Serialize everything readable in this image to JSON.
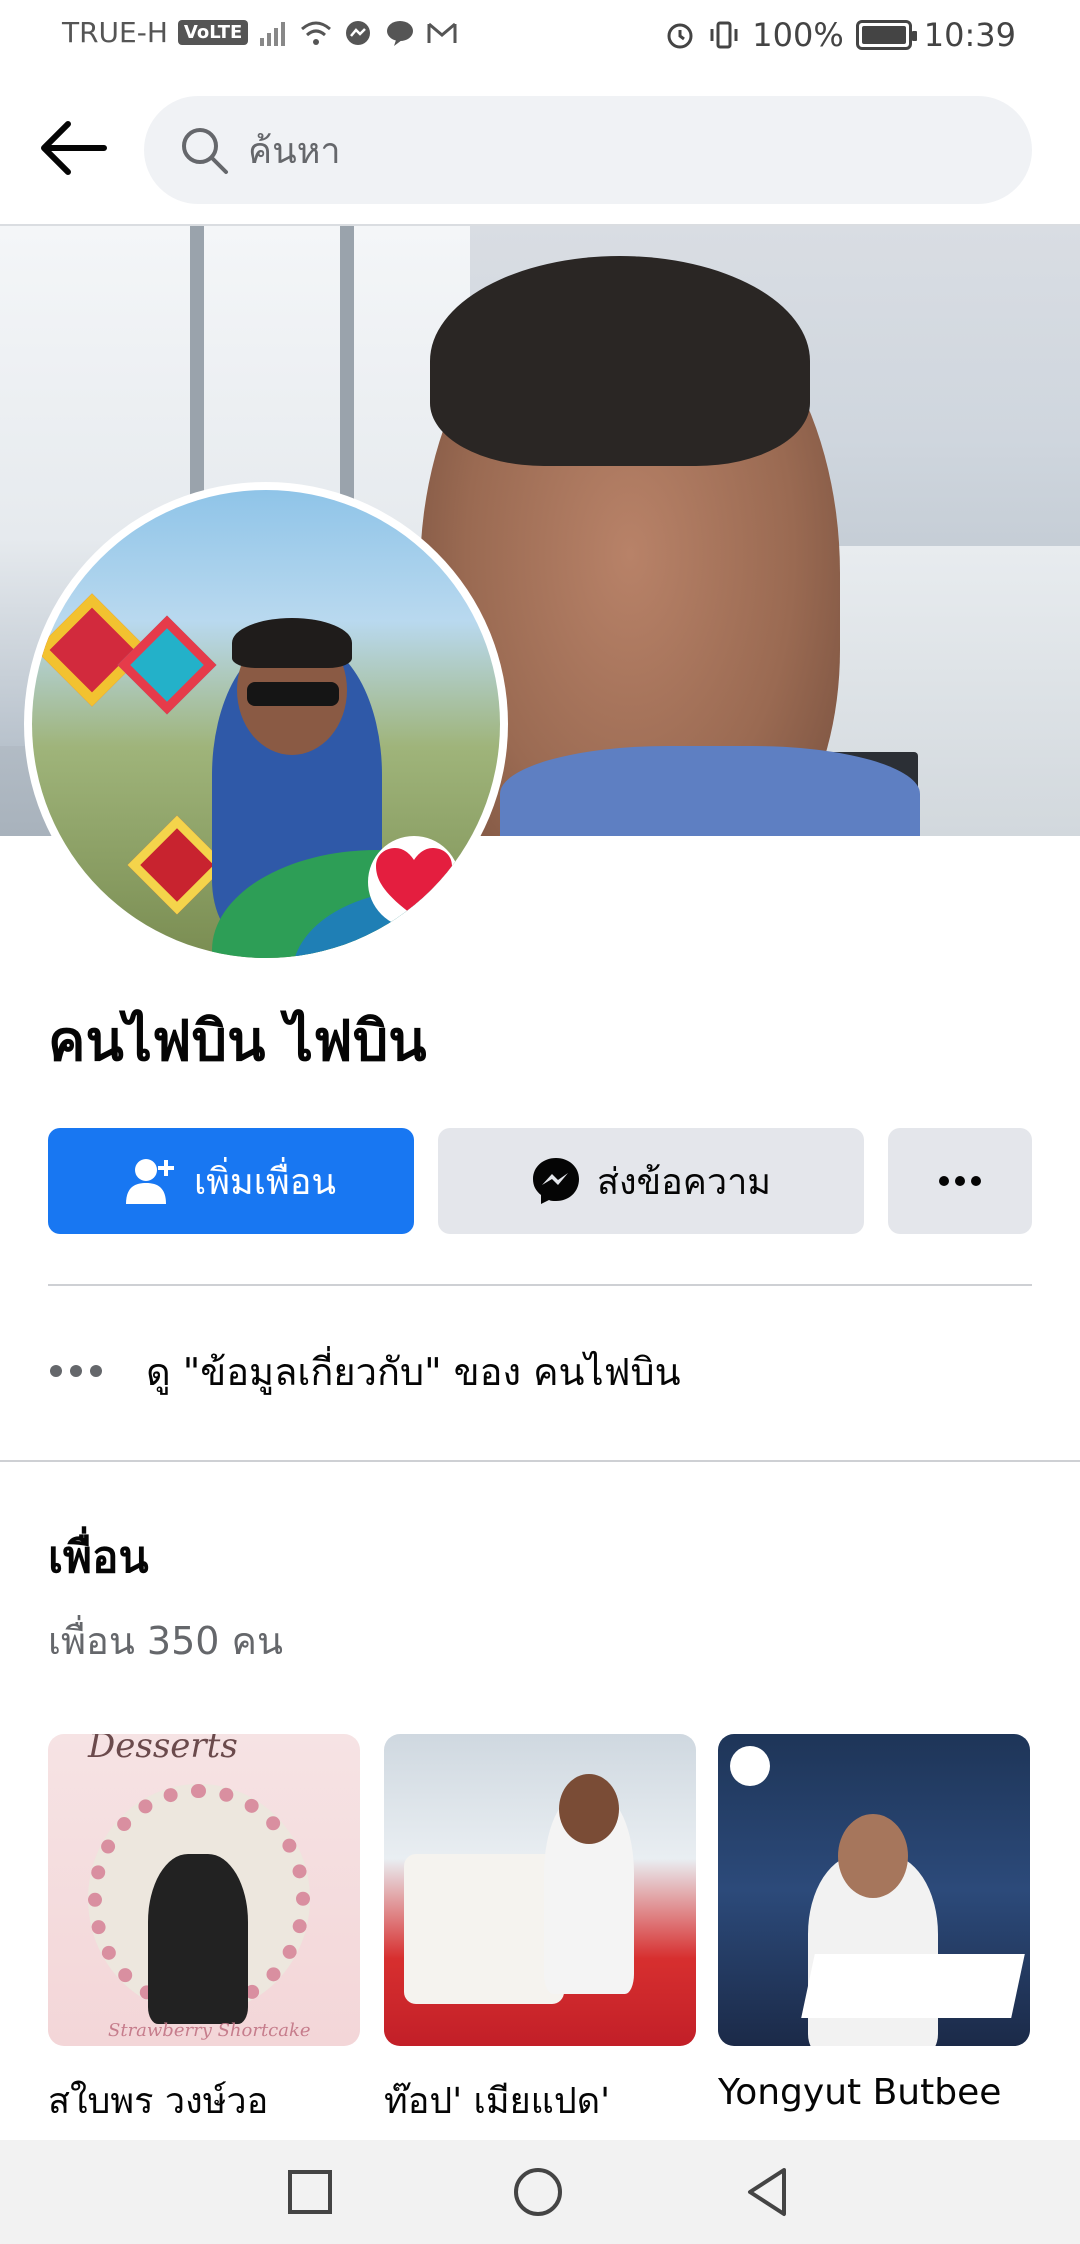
{
  "status_bar": {
    "carrier": "TRUE-H",
    "volte": "VoLTE",
    "battery_text": "100%",
    "time": "10:39"
  },
  "header": {
    "search_placeholder": "ค้นหา"
  },
  "profile": {
    "name": "คนไฟบิน ไฟบิน"
  },
  "actions": {
    "add_friend": "เพิ่มเพื่อน",
    "message": "ส่งข้อความ",
    "more": "•••"
  },
  "about": {
    "text": "ดู \"ข้อมูลเกี่ยวกับ\" ของ คนไฟบิน"
  },
  "friends": {
    "title": "เพื่อน",
    "count_text": "เพื่อน 350 คน",
    "items": [
      {
        "name": "สใบพร วงษ์วอ",
        "photo_title": "Desserts",
        "photo_caption": "Strawberry Shortcake"
      },
      {
        "name": "ท๊อป' เมียแปด'"
      },
      {
        "name": "Yongyut Butbee"
      }
    ]
  },
  "colors": {
    "primary": "#1877f2",
    "secondary_button": "#e4e6eb",
    "search_bg": "#f0f2f5",
    "heart": "#e41e3f"
  }
}
